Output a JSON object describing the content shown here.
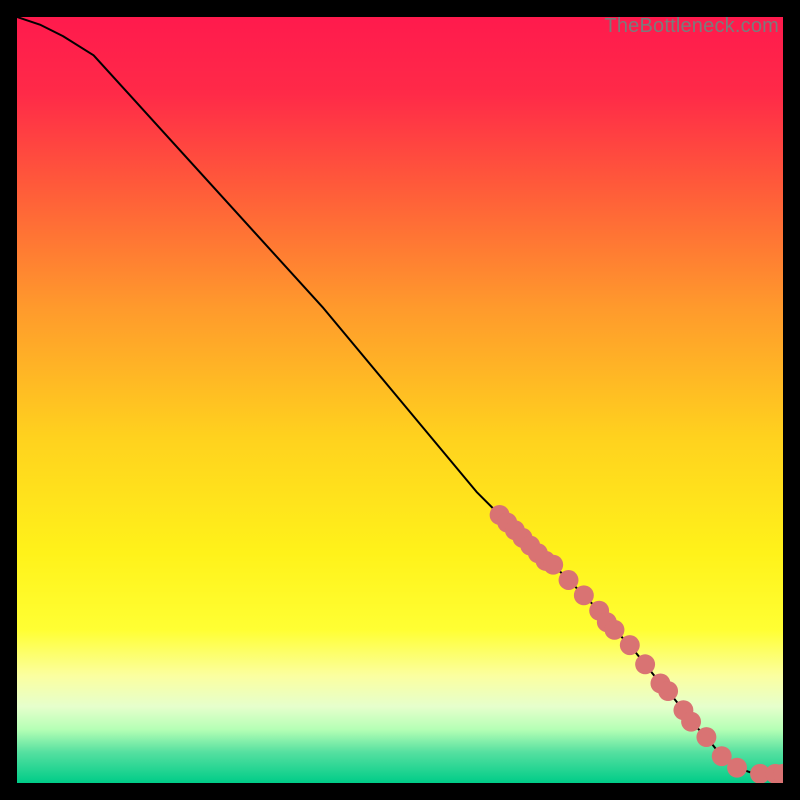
{
  "watermark": "TheBottleneck.com",
  "gradient_stops": [
    {
      "pct": 0,
      "color": "#ff1a4d"
    },
    {
      "pct": 10,
      "color": "#ff2a48"
    },
    {
      "pct": 22,
      "color": "#ff5a3a"
    },
    {
      "pct": 38,
      "color": "#ff9a2c"
    },
    {
      "pct": 55,
      "color": "#ffd21e"
    },
    {
      "pct": 70,
      "color": "#fff21a"
    },
    {
      "pct": 80,
      "color": "#ffff33"
    },
    {
      "pct": 86,
      "color": "#fbffa0"
    },
    {
      "pct": 90,
      "color": "#e6ffcc"
    },
    {
      "pct": 93,
      "color": "#b5ffb5"
    },
    {
      "pct": 96,
      "color": "#55e0a0"
    },
    {
      "pct": 100,
      "color": "#00cc88"
    }
  ],
  "chart_data": {
    "type": "line",
    "title": "",
    "xlabel": "",
    "ylabel": "",
    "xlim": [
      0,
      100
    ],
    "ylim": [
      0,
      100
    ],
    "series": [
      {
        "name": "curve",
        "x": [
          0,
          3,
          6,
          10,
          20,
          30,
          40,
          50,
          60,
          63,
          64,
          65,
          66,
          67,
          68,
          69,
          70,
          72,
          74,
          76,
          77,
          78,
          80,
          82,
          84,
          85,
          87,
          88,
          90,
          92,
          94,
          96,
          97,
          99,
          100
        ],
        "y": [
          100,
          99,
          97.5,
          95,
          84,
          73,
          62,
          50,
          38,
          35,
          34,
          33,
          32,
          31,
          30,
          29,
          28.5,
          26.5,
          24.5,
          22.5,
          21,
          20,
          18,
          15.5,
          13,
          12,
          9.5,
          8,
          6,
          3.5,
          2,
          1.3,
          1.2,
          1.2,
          1.2
        ]
      }
    ],
    "markers": {
      "color": "#d97373",
      "radius_pct": 0.013,
      "points": [
        {
          "x": 63,
          "y": 35
        },
        {
          "x": 64,
          "y": 34
        },
        {
          "x": 65,
          "y": 33
        },
        {
          "x": 66,
          "y": 32
        },
        {
          "x": 67,
          "y": 31
        },
        {
          "x": 68,
          "y": 30
        },
        {
          "x": 69,
          "y": 29
        },
        {
          "x": 70,
          "y": 28.5
        },
        {
          "x": 72,
          "y": 26.5
        },
        {
          "x": 74,
          "y": 24.5
        },
        {
          "x": 76,
          "y": 22.5
        },
        {
          "x": 77,
          "y": 21
        },
        {
          "x": 78,
          "y": 20
        },
        {
          "x": 80,
          "y": 18
        },
        {
          "x": 82,
          "y": 15.5
        },
        {
          "x": 84,
          "y": 13
        },
        {
          "x": 85,
          "y": 12
        },
        {
          "x": 87,
          "y": 9.5
        },
        {
          "x": 88,
          "y": 8
        },
        {
          "x": 90,
          "y": 6
        },
        {
          "x": 92,
          "y": 3.5
        },
        {
          "x": 94,
          "y": 2
        },
        {
          "x": 97,
          "y": 1.2
        },
        {
          "x": 99,
          "y": 1.2
        },
        {
          "x": 100,
          "y": 1.2
        }
      ]
    }
  }
}
